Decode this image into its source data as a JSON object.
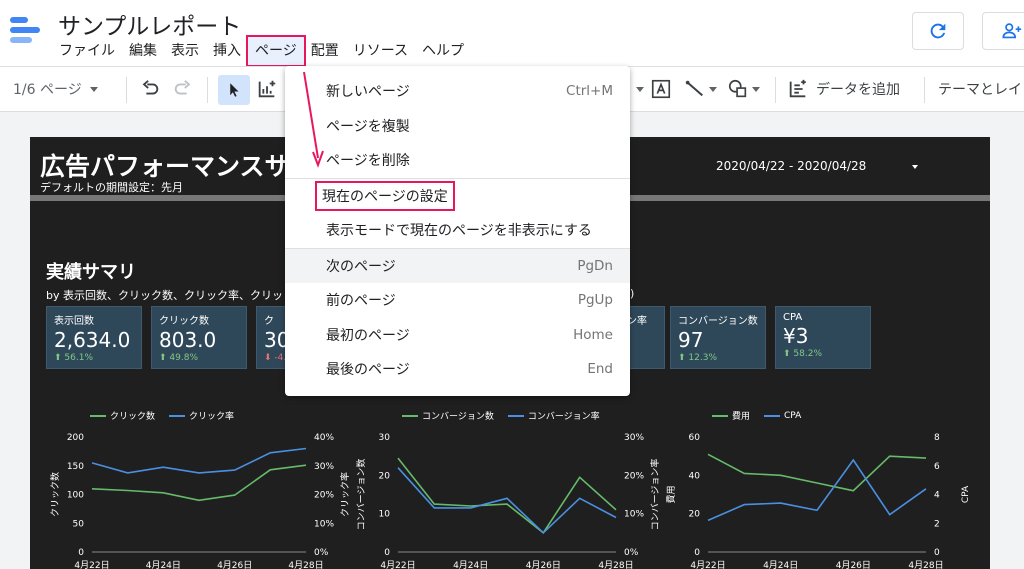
{
  "app": {
    "doc_title": "サンプルレポート",
    "menus": [
      "ファイル",
      "編集",
      "表示",
      "挿入",
      "ページ",
      "配置",
      "リソース",
      "ヘルプ"
    ],
    "active_menu": "ページ"
  },
  "toolbar": {
    "page_selector": "1/6 ページ",
    "add_data": "データを追加",
    "theme": "テーマとレイ"
  },
  "report": {
    "title": "広告パフォーマンスサ",
    "subtitle": "デフォルトの期間設定：先月",
    "date_range": "2020/04/22 - 2020/04/28",
    "section_title": "実績サマリ",
    "section_subtitle": "by 表示回数、クリック数、クリック率、クリッ",
    "section_subtitle_tail": ")",
    "scorecards": [
      {
        "label": "表示回数",
        "value": "2,634.0",
        "delta": "⬆ 56.1%",
        "negative": false
      },
      {
        "label": "クリック数",
        "value": "803.0",
        "delta": "⬆ 49.8%",
        "negative": false
      },
      {
        "label": "ク",
        "value": "30",
        "delta": "⬇ -4.",
        "negative": true
      },
      {
        "label": "ョン率",
        "value": "",
        "delta": "",
        "negative": false
      },
      {
        "label": "コンバージョン数",
        "value": "97",
        "delta": "⬆ 12.3%",
        "negative": false
      },
      {
        "label": "CPA",
        "value": "¥3",
        "delta": "⬆ 58.2%",
        "negative": false
      }
    ]
  },
  "dropdown": {
    "items": [
      {
        "label": "新しいページ",
        "shortcut": "Ctrl+M"
      },
      {
        "label": "ページを複製",
        "shortcut": ""
      },
      {
        "label": "ページを削除",
        "shortcut": ""
      },
      {
        "divider": true
      },
      {
        "label": "現在のページの設定",
        "shortcut": "",
        "highlighted": true
      },
      {
        "label": "表示モードで現在のページを非表示にする",
        "shortcut": ""
      },
      {
        "divider": true
      },
      {
        "label": "次のページ",
        "shortcut": "PgDn",
        "hover": true
      },
      {
        "label": "前のページ",
        "shortcut": "PgUp"
      },
      {
        "label": "最初のページ",
        "shortcut": "Home"
      },
      {
        "label": "最後のページ",
        "shortcut": "End"
      }
    ]
  },
  "colors": {
    "accent_highlight": "#e8175d",
    "series_green": "#66bb6a",
    "series_blue": "#4a90e2",
    "card_bg": "#2f4859",
    "report_bg": "#1f1f1f"
  },
  "chart_data": [
    {
      "type": "line",
      "x": [
        "4月22日",
        "4月23日",
        "4月24日",
        "4月25日",
        "4月26日",
        "4月27日",
        "4月28日"
      ],
      "x_tick_labels": [
        "4月22日",
        "4月24日",
        "4月26日",
        "4月28日"
      ],
      "ylabel": "クリック数",
      "y2label": "クリック率",
      "ylim": [
        0,
        200
      ],
      "y_ticks": [
        "0",
        "50",
        "100",
        "150",
        "200"
      ],
      "y2lim": [
        0,
        40
      ],
      "y2_ticks": [
        "0%",
        "10%",
        "20%",
        "30%",
        "40%"
      ],
      "series": [
        {
          "name": "クリック数",
          "color": "#66bb6a",
          "axis": "left",
          "values": [
            110,
            107,
            103,
            90,
            99,
            143,
            151
          ]
        },
        {
          "name": "クリック率",
          "color": "#4a90e2",
          "axis": "right",
          "values": [
            31,
            27.5,
            29.5,
            27.5,
            28.5,
            34.5,
            36
          ]
        }
      ],
      "legend": "top"
    },
    {
      "type": "line",
      "x": [
        "4月22日",
        "4月23日",
        "4月24日",
        "4月25日",
        "4月26日",
        "4月27日",
        "4月28日"
      ],
      "x_tick_labels": [
        "4月22日",
        "4月24日",
        "4月26日",
        "4月28日"
      ],
      "ylabel": "コンバージョン数",
      "y2label": "コンバージョン率",
      "ylim": [
        0,
        30
      ],
      "y_ticks": [
        "0",
        "10",
        "20",
        "30"
      ],
      "y2lim": [
        0,
        30
      ],
      "y2_ticks": [
        "0%",
        "10%",
        "20%",
        "30%"
      ],
      "series": [
        {
          "name": "コンバージョン数",
          "color": "#66bb6a",
          "axis": "left",
          "values": [
            24.5,
            12.5,
            12,
            12.5,
            5,
            19.5,
            11
          ]
        },
        {
          "name": "コンバージョン率",
          "color": "#4a90e2",
          "axis": "right",
          "values": [
            22,
            11.5,
            11.5,
            14,
            5,
            14,
            9
          ]
        }
      ],
      "legend": "top"
    },
    {
      "type": "line",
      "x": [
        "4月22日",
        "4月23日",
        "4月24日",
        "4月25日",
        "4月26日",
        "4月27日",
        "4月28日"
      ],
      "x_tick_labels": [
        "4月22日",
        "4月24日",
        "4月26日",
        "4月28日"
      ],
      "ylabel": "費用",
      "y2label": "CPA",
      "ylim": [
        0,
        60
      ],
      "y_ticks": [
        "0",
        "20",
        "40",
        "60"
      ],
      "y2lim": [
        0,
        8
      ],
      "y2_ticks": [
        "0",
        "2",
        "4",
        "6",
        "8"
      ],
      "series": [
        {
          "name": "費用",
          "color": "#66bb6a",
          "axis": "left",
          "values": [
            51,
            41,
            40,
            36,
            32,
            50,
            49
          ]
        },
        {
          "name": "CPA",
          "color": "#4a90e2",
          "axis": "right",
          "values": [
            2.2,
            3.3,
            3.4,
            2.9,
            6.4,
            2.6,
            4.4
          ]
        }
      ],
      "legend": "top"
    }
  ]
}
